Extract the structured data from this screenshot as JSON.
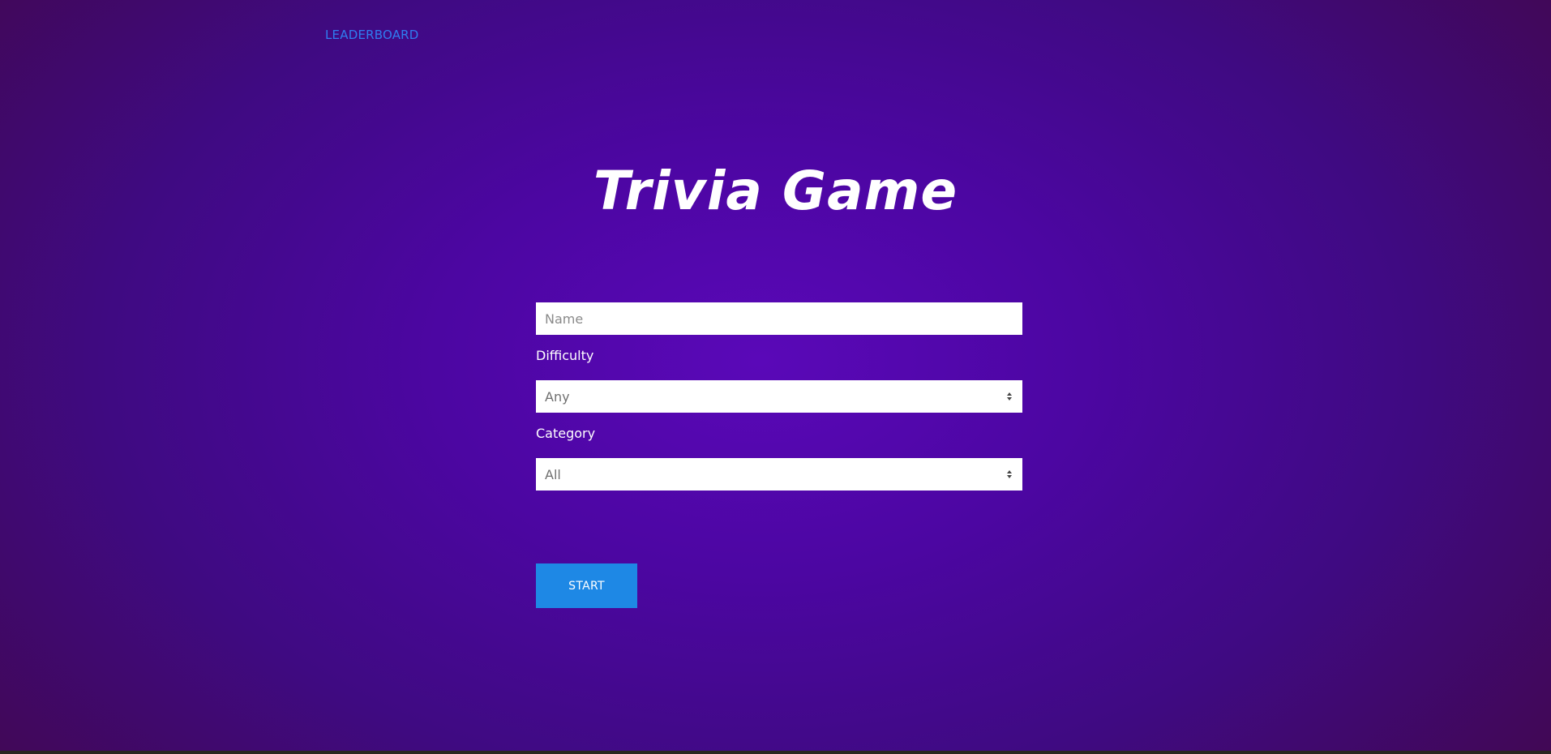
{
  "nav": {
    "leaderboard_label": "LEADERBOARD"
  },
  "header": {
    "title": "Trivia Game"
  },
  "form": {
    "name_placeholder": "Name",
    "name_value": "",
    "difficulty_label": "Difficulty",
    "difficulty_value": "Any",
    "category_label": "Category",
    "category_value": "All",
    "start_label": "START"
  },
  "colors": {
    "background_center": "#5a08b8",
    "background_edge": "#420748",
    "link": "#2f7df0",
    "button": "#1e88e5"
  }
}
